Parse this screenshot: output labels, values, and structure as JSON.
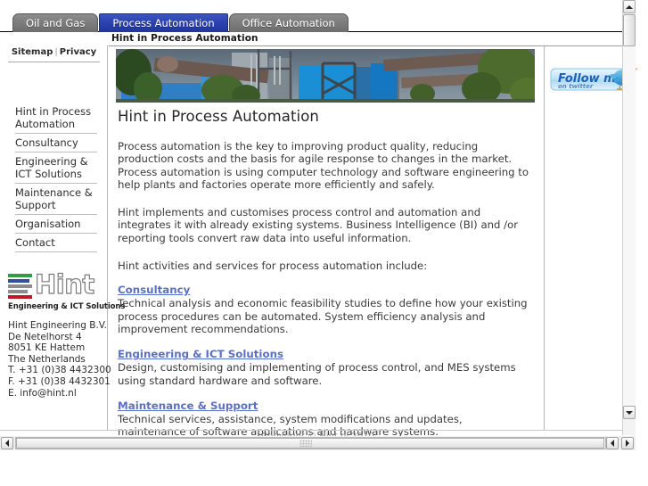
{
  "window": {
    "page_title": "Hint in Process Automation"
  },
  "tabs": [
    {
      "label": "Oil and Gas",
      "active": false
    },
    {
      "label": "Process Automation",
      "active": true
    },
    {
      "label": "Office Automation",
      "active": false
    }
  ],
  "sidebar": {
    "utility": {
      "sitemap": "Sitemap",
      "separator": "|",
      "privacy": "Privacy"
    },
    "nav": [
      {
        "label": "Hint in Process Automation"
      },
      {
        "label": "Consultancy"
      },
      {
        "label": "Engineering & ICT Solutions"
      },
      {
        "label": "Maintenance & Support"
      },
      {
        "label": "Organisation"
      },
      {
        "label": "Contact"
      }
    ],
    "logo": {
      "wordmark": "Hint",
      "tagline": "Engineering & ICT Solutions"
    },
    "contact": {
      "company": "Hint Engineering B.V.",
      "street": "De Netelhorst 4",
      "postcode_city": "8051 KE Hattem",
      "country": "The Netherlands",
      "phone": "T. +31 (0)38 4432300",
      "fax": "F. +31 (0)38 4432301",
      "email": "E. info@hint.nl"
    }
  },
  "content": {
    "heading": "Hint in Process Automation",
    "paragraph1": "Process automation is the key to improving product quality, reducing production costs and the basis for agile response to changes in the market. Process automation is using computer technology and software engineering to help plants and factories operate more efficiently and safely.",
    "paragraph2": "Hint implements and customises process control and automation and integrates it with already existing systems. Business Intelligence (BI) and /or reporting tools convert raw data into useful information.",
    "paragraph3": "Hint activities and services for process automation include:",
    "services": [
      {
        "link": "Consultancy",
        "text": "Technical analysis and economic feasibility studies to define how your existing process procedures can be automated. System efficiency analysis and improvement recommendations."
      },
      {
        "link": "Engineering & ICT Solutions",
        "text": "Design, customising and implementing of process control, and MES systems using standard hardware and software."
      },
      {
        "link": "Maintenance & Support",
        "text": "Technical services, assistance, system modifications and updates, maintenance of software applications and hardware systems."
      }
    ]
  },
  "right_column": {
    "twitter_badge": {
      "line1": "Follow me",
      "line2": "on twitter"
    }
  },
  "footer": {
    "copyright": "Copyright © Hint.nl 2010"
  },
  "colors": {
    "active_tab": "#2b41ae",
    "inactive_tab": "#7d7d7d",
    "link": "#5b6fc4",
    "body_text": "#3a3a3a",
    "logo_green": "#2f9e4a",
    "logo_blue": "#2f4fa0",
    "logo_gray": "#8d8d8d",
    "logo_red": "#c2162b"
  }
}
